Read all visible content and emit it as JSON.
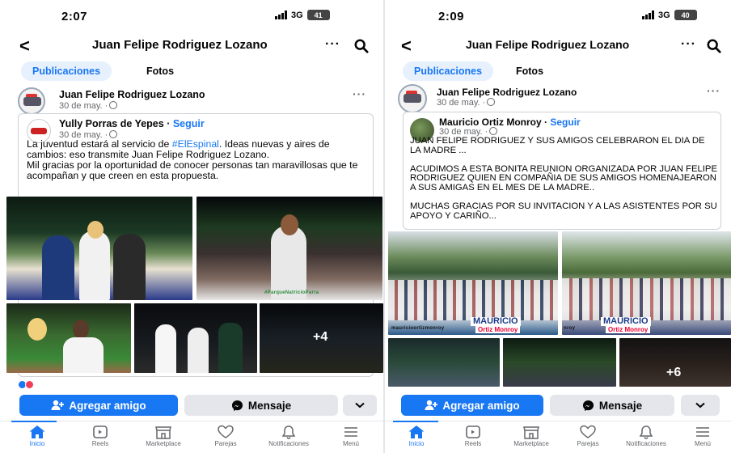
{
  "colors": {
    "accent": "#1877f2",
    "secondary_bg": "#e4e6eb",
    "muted": "#65676b"
  },
  "screens": [
    {
      "status": {
        "time": "2:07",
        "network": "3G",
        "battery": "41"
      },
      "header": {
        "title": "Juan Felipe Rodriguez Lozano",
        "back_icon": "chevron-left-icon",
        "more_icon": "more-horizontal-icon",
        "search_icon": "search-icon"
      },
      "tabs": [
        "Publicaciones",
        "Fotos"
      ],
      "post": {
        "author": "Juan Felipe Rodriguez Lozano",
        "date": "30 de may. ·",
        "shared": {
          "author": "Yully Porras de Yepes",
          "follow": "Seguir",
          "date": "30 de may. ·",
          "text_before_tag": "La juventud estará al servicio de ",
          "hashtag": "#ElEspinal",
          "text_after_tag": ". Ideas nuevas y aires de cambios: eso transmite Juan Felipe Rodriguez Lozano.\nMil gracias por la oportunidad de conocer personas tan maravillosas que te acompañan y que creen en esta propuesta."
        },
        "more_photos": "+4",
        "watermark": "#ParqueNatricioParra"
      },
      "actions": {
        "add_friend": "Agregar amigo",
        "message": "Mensaje"
      },
      "nav": [
        "Inicio",
        "Reels",
        "Marketplace",
        "Parejas",
        "Notificaciones",
        "Menú"
      ]
    },
    {
      "status": {
        "time": "2:09",
        "network": "3G",
        "battery": "40"
      },
      "header": {
        "title": "Juan Felipe Rodriguez Lozano",
        "back_icon": "chevron-left-icon",
        "more_icon": "more-horizontal-icon",
        "search_icon": "search-icon"
      },
      "tabs": [
        "Publicaciones",
        "Fotos"
      ],
      "post": {
        "author": "Juan Felipe Rodriguez Lozano",
        "date": "30 de may. ·",
        "shared": {
          "author": "Mauricio Ortiz Monroy",
          "follow": "Seguir",
          "date": "30 de may. ·",
          "text": "JUAN FELIPE RODRIGUEZ Y SUS AMIGOS CELEBRARON EL DIA DE LA MADRE ...\n\nACUDIMOS A ESTA BONITA REUNION ORGANIZADA POR JUAN FELIPE RODRIGUEZ QUIEN EN COMPAÑIA DE SUS AMIGOS HOMENAJEARON A SUS AMIGAS EN EL MES DE LA MADRE..\n\nMUCHAS GRACIAS POR SU INVITACION Y A LAS ASISTENTES POR SU APOYO Y CARIÑO..."
        },
        "more_photos": "+6",
        "watermark_name": "MAURICIO",
        "watermark_sub": "Ortiz Monroy",
        "watermark_handle": "mauricioortizmonroy",
        "watermark_handle2": "nroy"
      },
      "actions": {
        "add_friend": "Agregar amigo",
        "message": "Mensaje"
      },
      "nav": [
        "Inicio",
        "Reels",
        "Marketplace",
        "Parejas",
        "Notificaciones",
        "Menú"
      ]
    }
  ]
}
